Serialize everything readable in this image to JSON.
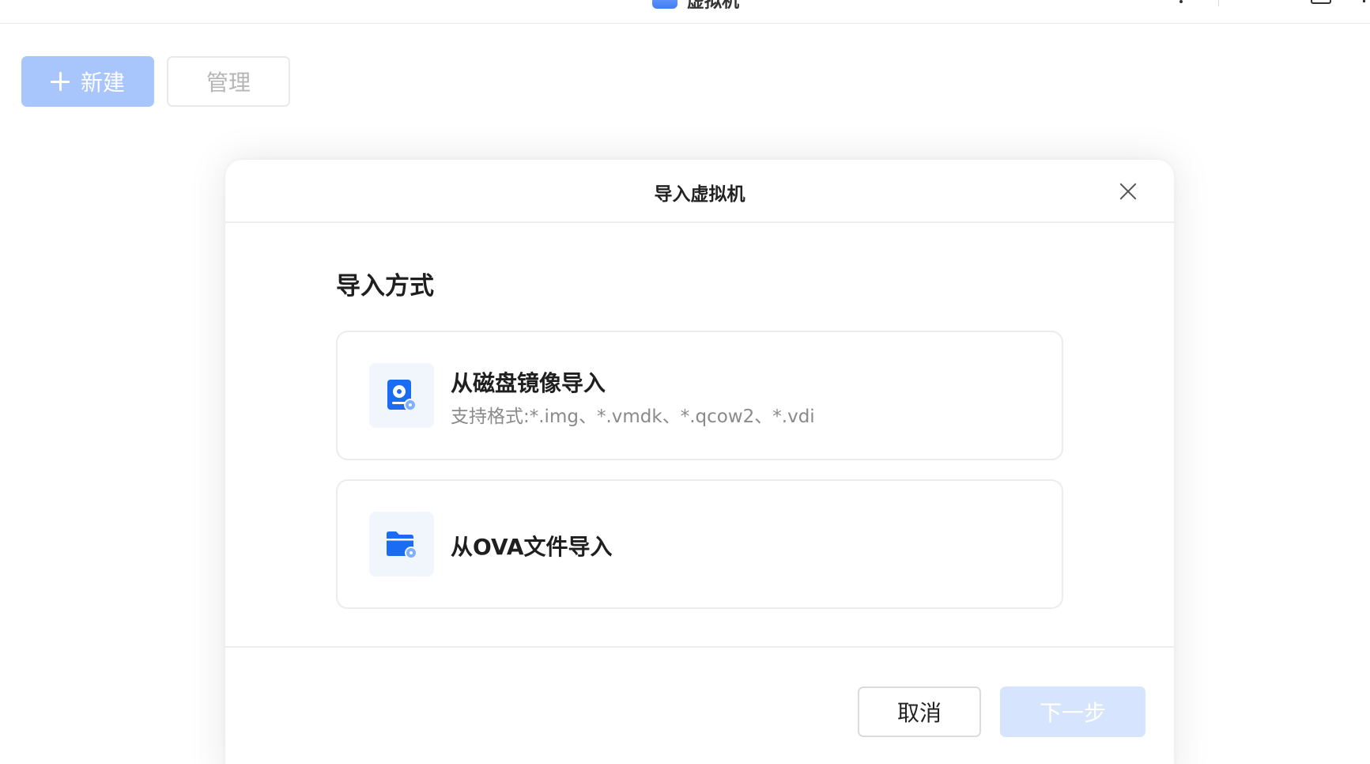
{
  "app": {
    "title": "虚拟机",
    "icon": "app-logo-icon"
  },
  "toolbar": {
    "new_label": "新建",
    "manage_label": "管理"
  },
  "dialog": {
    "title": "导入虚拟机",
    "section_title": "导入方式",
    "options": [
      {
        "title": "从磁盘镜像导入",
        "subtitle": "支持格式:*.img、*.vmdk、*.qcow2、*.vdi",
        "icon": "disk-image-icon"
      },
      {
        "title": "从OVA文件导入",
        "icon": "folder-icon"
      }
    ],
    "cancel_label": "取消",
    "next_label": "下一步"
  },
  "colors": {
    "primary": "#3f7cf5",
    "primary_disabled": "#a9c6fc",
    "next_disabled": "#d6e4fd",
    "icon_blue": "#1a6cf2"
  }
}
